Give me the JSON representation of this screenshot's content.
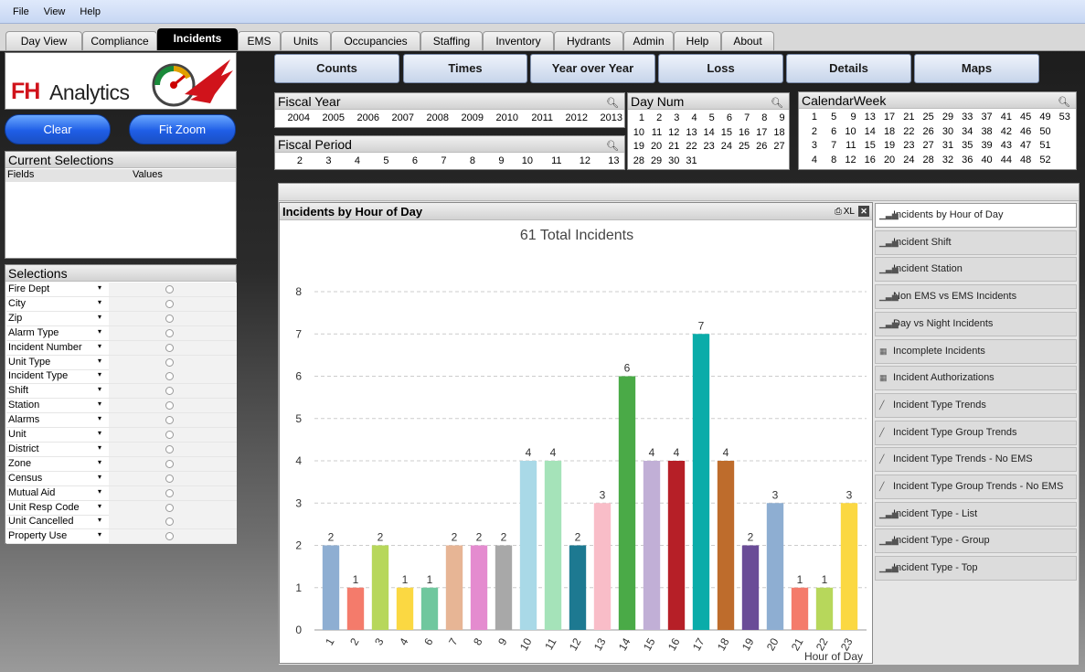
{
  "menu": [
    "File",
    "View",
    "Help"
  ],
  "tabs": [
    "Day View",
    "Compliance",
    "Incidents",
    "EMS",
    "Units",
    "Occupancies",
    "Staffing",
    "Inventory",
    "Hydrants",
    "Admin",
    "Help",
    "About"
  ],
  "active_tab": "Incidents",
  "logo": {
    "fh": "FH",
    "analytics": "Analytics"
  },
  "buttons": {
    "clear": "Clear",
    "fit_zoom": "Fit Zoom"
  },
  "nav_buttons": [
    "Counts",
    "Times",
    "Year over Year",
    "Loss",
    "Details",
    "Maps"
  ],
  "fiscal_year": {
    "title": "Fiscal Year",
    "values": [
      "2004",
      "2005",
      "2006",
      "2007",
      "2008",
      "2009",
      "2010",
      "2011",
      "2012",
      "2013"
    ]
  },
  "fiscal_period": {
    "title": "Fiscal Period",
    "values": [
      "2",
      "3",
      "4",
      "5",
      "6",
      "7",
      "8",
      "9",
      "10",
      "11",
      "12",
      "13"
    ]
  },
  "day_num": {
    "title": "Day Num",
    "rows": [
      [
        "1",
        "2",
        "3",
        "4",
        "5",
        "6",
        "7",
        "8",
        "9"
      ],
      [
        "10",
        "11",
        "12",
        "13",
        "14",
        "15",
        "16",
        "17",
        "18"
      ],
      [
        "19",
        "20",
        "21",
        "22",
        "23",
        "24",
        "25",
        "26",
        "27"
      ],
      [
        "28",
        "29",
        "30",
        "31"
      ]
    ]
  },
  "calendar_week": {
    "title": "CalendarWeek",
    "rows": [
      [
        "1",
        "5",
        "9",
        "13",
        "17",
        "21",
        "25",
        "29",
        "33",
        "37",
        "41",
        "45",
        "49",
        "53"
      ],
      [
        "2",
        "6",
        "10",
        "14",
        "18",
        "22",
        "26",
        "30",
        "34",
        "38",
        "42",
        "46",
        "50"
      ],
      [
        "3",
        "7",
        "11",
        "15",
        "19",
        "23",
        "27",
        "31",
        "35",
        "39",
        "43",
        "47",
        "51"
      ],
      [
        "4",
        "8",
        "12",
        "16",
        "20",
        "24",
        "28",
        "32",
        "36",
        "40",
        "44",
        "48",
        "52"
      ]
    ]
  },
  "current_selections": {
    "title": "Current Selections",
    "col_fields": "Fields",
    "col_values": "Values"
  },
  "selections": {
    "title": "Selections",
    "fields": [
      "Fire Dept",
      "City",
      "Zip",
      "Alarm Type",
      "Incident Number",
      "Unit Type",
      "Incident Type",
      "Shift",
      "Station",
      "Alarms",
      "Unit",
      "District",
      "Zone",
      "Census",
      "Mutual Aid",
      "Unit Resp Code",
      "Unit Cancelled",
      "Property Use"
    ]
  },
  "chart_panel": {
    "title": "Incidents by Hour of Day",
    "xl_label": "XL"
  },
  "chart_data": {
    "type": "bar",
    "title": "61 Total Incidents",
    "xlabel": "Hour of Day",
    "ylabel": "",
    "ylim": [
      0,
      8
    ],
    "yticks": [
      "0",
      "1",
      "2",
      "3",
      "4",
      "5",
      "6",
      "7",
      "8"
    ],
    "categories": [
      "1",
      "2",
      "3",
      "4",
      "6",
      "7",
      "8",
      "9",
      "10",
      "11",
      "12",
      "13",
      "14",
      "15",
      "16",
      "17",
      "18",
      "19",
      "20",
      "21",
      "22",
      "23"
    ],
    "values": [
      2,
      1,
      2,
      1,
      1,
      2,
      2,
      2,
      4,
      4,
      2,
      3,
      6,
      4,
      4,
      7,
      4,
      2,
      3,
      1,
      1,
      3
    ],
    "colors": [
      "#8eaed2",
      "#f47b6b",
      "#b7d75b",
      "#fbd842",
      "#6fc79e",
      "#e7b595",
      "#e48bcf",
      "#a8a8a8",
      "#a9d9e7",
      "#a5e3b9",
      "#1d7991",
      "#f9bdc8",
      "#4aaa47",
      "#c1afd6",
      "#b61f27",
      "#0aaca9",
      "#be6c2c",
      "#6a4c97",
      "#8eaed2",
      "#f47b6b",
      "#b7d75b",
      "#fbd842"
    ]
  },
  "side_list": [
    {
      "label": "Incidents by Hour of Day",
      "icon": "bar-chart-icon",
      "active": true
    },
    {
      "label": "Incident Shift",
      "icon": "bar-chart-icon"
    },
    {
      "label": "Incident Station",
      "icon": "bar-chart-icon"
    },
    {
      "label": "Non EMS vs EMS Incidents",
      "icon": "bar-chart-icon"
    },
    {
      "label": "Day vs Night Incidents",
      "icon": "bar-chart-icon"
    },
    {
      "label": "Incomplete Incidents",
      "icon": "table-icon"
    },
    {
      "label": "Incident Authorizations",
      "icon": "table-icon"
    },
    {
      "label": "Incident Type Trends",
      "icon": "line-chart-icon"
    },
    {
      "label": "Incident Type  Group Trends",
      "icon": "line-chart-icon"
    },
    {
      "label": "Incident Type Trends - No EMS",
      "icon": "line-chart-icon"
    },
    {
      "label": "Incident Type  Group Trends - No EMS",
      "icon": "line-chart-icon"
    },
    {
      "label": "Incident Type - List",
      "icon": "bar-chart-icon"
    },
    {
      "label": "Incident Type - Group",
      "icon": "bar-chart-icon"
    },
    {
      "label": "Incident Type - Top",
      "icon": "bar-chart-icon"
    }
  ],
  "colors": {
    "accent_blue": "#1f5ee6",
    "logo_red": "#d0131b"
  }
}
